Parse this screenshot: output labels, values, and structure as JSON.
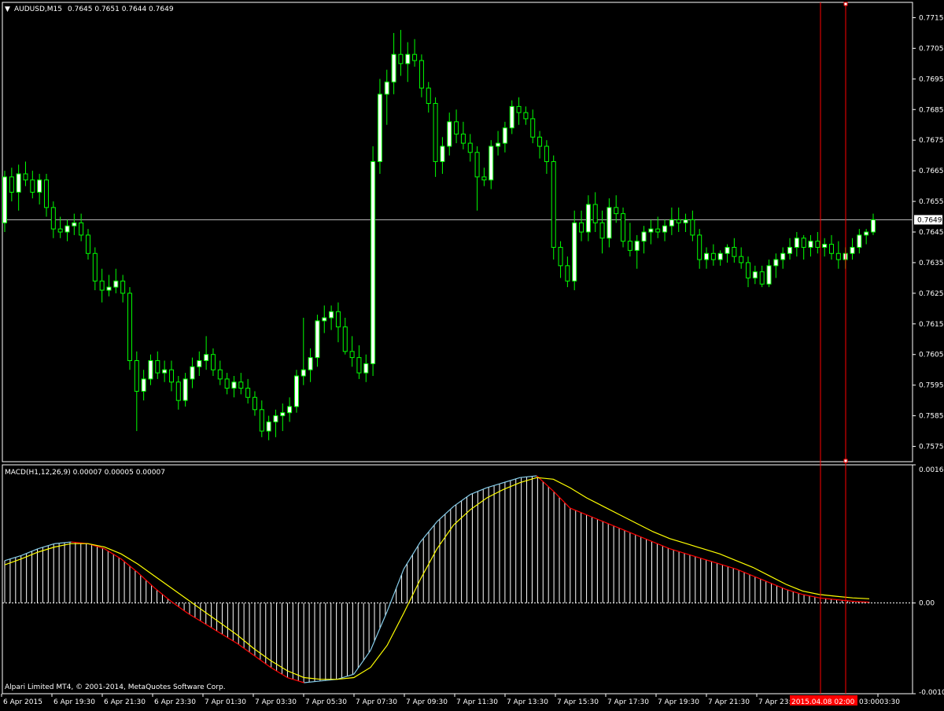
{
  "symbol_header": {
    "symbol": "AUDUSD,M15",
    "ohlc_text": "0.7645 0.7651 0.7644 0.7649"
  },
  "colors": {
    "background": "#000000",
    "frame": "#ffffff",
    "candle_bull_body": "#ffffff",
    "candle_wick": "#00ff00",
    "bid_line": "#c0c0c0",
    "vline": "#ff0000",
    "macd_hist_rising": "#87ceeb",
    "macd_hist": "#ffffff",
    "macd_signal": "#ffff00",
    "macd_falling": "#ff0000",
    "time_marker_bg": "#ff0000"
  },
  "price_axis": {
    "ticks": [
      "0.7715",
      "0.7705",
      "0.7695",
      "0.7685",
      "0.7675",
      "0.7665",
      "0.7655",
      "0.7645",
      "0.7635",
      "0.7625",
      "0.7615",
      "0.7605",
      "0.7595",
      "0.7585",
      "0.7575"
    ],
    "current_price": "0.7649"
  },
  "indicator": {
    "label": "MACD(H1,12,26,9) 0.00007 0.00005 0.00007",
    "axis_ticks": [
      "0.00163",
      "0.00",
      "-0.00107"
    ]
  },
  "copyright": "Alpari Limited MT4, © 2001-2014, MetaQuotes Software Corp.",
  "time_axis": {
    "labels": [
      "6 Apr 2015",
      "6 Apr 19:30",
      "6 Apr 21:30",
      "6 Apr 23:30",
      "7 Apr 01:30",
      "7 Apr 03:30",
      "7 Apr 05:30",
      "7 Apr 07:30",
      "7 Apr 09:30",
      "7 Apr 11:30",
      "7 Apr 13:30",
      "7 Apr 15:30",
      "7 Apr 17:30",
      "7 Apr 19:30",
      "7 Apr 21:30",
      "7 Apr 23:",
      "03:30"
    ],
    "cursor_time": "2015.04.08 02:00",
    "cursor_time_2": "03:00"
  },
  "chart_data": [
    {
      "type": "candlestick",
      "title": "AUDUSD,M15",
      "timeframe": "M15",
      "ylim": [
        0.757,
        0.772
      ],
      "current_price": 0.7649,
      "candles": [
        [
          0.7648,
          0.7665,
          0.7645,
          0.7663
        ],
        [
          0.7663,
          0.7666,
          0.7655,
          0.7658
        ],
        [
          0.7658,
          0.7667,
          0.7652,
          0.7664
        ],
        [
          0.7664,
          0.7668,
          0.766,
          0.7662
        ],
        [
          0.7662,
          0.7665,
          0.7656,
          0.7658
        ],
        [
          0.7658,
          0.7664,
          0.7654,
          0.7662
        ],
        [
          0.7662,
          0.7664,
          0.765,
          0.7653
        ],
        [
          0.7653,
          0.7655,
          0.7643,
          0.7646
        ],
        [
          0.7646,
          0.765,
          0.7643,
          0.7645
        ],
        [
          0.7645,
          0.7649,
          0.7642,
          0.7647
        ],
        [
          0.7647,
          0.7651,
          0.7644,
          0.7648
        ],
        [
          0.7648,
          0.7651,
          0.7642,
          0.7644
        ],
        [
          0.7644,
          0.7646,
          0.7636,
          0.7638
        ],
        [
          0.7638,
          0.764,
          0.7626,
          0.7629
        ],
        [
          0.7629,
          0.7633,
          0.7622,
          0.7626
        ],
        [
          0.7626,
          0.7631,
          0.7624,
          0.7627
        ],
        [
          0.7627,
          0.7633,
          0.7625,
          0.7629
        ],
        [
          0.7629,
          0.7631,
          0.7622,
          0.7625
        ],
        [
          0.7625,
          0.7627,
          0.76,
          0.7603
        ],
        [
          0.7603,
          0.7606,
          0.758,
          0.7593
        ],
        [
          0.7593,
          0.76,
          0.759,
          0.7597
        ],
        [
          0.7597,
          0.7605,
          0.7595,
          0.7603
        ],
        [
          0.7603,
          0.7606,
          0.7597,
          0.7599
        ],
        [
          0.7599,
          0.7603,
          0.7596,
          0.76
        ],
        [
          0.76,
          0.7603,
          0.7593,
          0.7596
        ],
        [
          0.7596,
          0.7598,
          0.7587,
          0.759
        ],
        [
          0.759,
          0.7599,
          0.7588,
          0.7597
        ],
        [
          0.7597,
          0.7604,
          0.7594,
          0.7601
        ],
        [
          0.7601,
          0.7606,
          0.7598,
          0.7603
        ],
        [
          0.7603,
          0.7611,
          0.76,
          0.7605
        ],
        [
          0.7605,
          0.7607,
          0.7598,
          0.76
        ],
        [
          0.76,
          0.7603,
          0.7595,
          0.7597
        ],
        [
          0.7597,
          0.7599,
          0.7592,
          0.7594
        ],
        [
          0.7594,
          0.7598,
          0.7591,
          0.7596
        ],
        [
          0.7596,
          0.7599,
          0.7592,
          0.7594
        ],
        [
          0.7594,
          0.7597,
          0.7589,
          0.7591
        ],
        [
          0.7591,
          0.7593,
          0.7585,
          0.7587
        ],
        [
          0.7587,
          0.759,
          0.7578,
          0.758
        ],
        [
          0.758,
          0.7585,
          0.7577,
          0.7583
        ],
        [
          0.7583,
          0.7587,
          0.7578,
          0.7585
        ],
        [
          0.7585,
          0.7589,
          0.758,
          0.7586
        ],
        [
          0.7586,
          0.7591,
          0.7583,
          0.7588
        ],
        [
          0.7588,
          0.76,
          0.7586,
          0.7598
        ],
        [
          0.7598,
          0.7617,
          0.7595,
          0.76
        ],
        [
          0.76,
          0.7607,
          0.7596,
          0.7604
        ],
        [
          0.7604,
          0.7618,
          0.7601,
          0.7616
        ],
        [
          0.7616,
          0.7621,
          0.7612,
          0.7617
        ],
        [
          0.7617,
          0.7621,
          0.7613,
          0.7619
        ],
        [
          0.7619,
          0.7622,
          0.7609,
          0.7614
        ],
        [
          0.7614,
          0.7617,
          0.7605,
          0.7606
        ],
        [
          0.7606,
          0.7611,
          0.7601,
          0.7604
        ],
        [
          0.7604,
          0.7608,
          0.7597,
          0.7599
        ],
        [
          0.7599,
          0.7605,
          0.7596,
          0.7602
        ],
        [
          0.7602,
          0.7673,
          0.7598,
          0.7668
        ],
        [
          0.7668,
          0.7695,
          0.7664,
          0.769
        ],
        [
          0.769,
          0.7698,
          0.768,
          0.7694
        ],
        [
          0.7694,
          0.771,
          0.769,
          0.7703
        ],
        [
          0.7703,
          0.7711,
          0.7696,
          0.77
        ],
        [
          0.77,
          0.7707,
          0.7694,
          0.7703
        ],
        [
          0.7703,
          0.7708,
          0.7699,
          0.7701
        ],
        [
          0.7701,
          0.7703,
          0.7689,
          0.7692
        ],
        [
          0.7692,
          0.7694,
          0.7684,
          0.7687
        ],
        [
          0.7687,
          0.7689,
          0.7663,
          0.7668
        ],
        [
          0.7668,
          0.7676,
          0.7664,
          0.7673
        ],
        [
          0.7673,
          0.7684,
          0.767,
          0.7681
        ],
        [
          0.7681,
          0.7685,
          0.7674,
          0.7677
        ],
        [
          0.7677,
          0.7681,
          0.7672,
          0.7674
        ],
        [
          0.7674,
          0.7677,
          0.7668,
          0.7671
        ],
        [
          0.7671,
          0.7673,
          0.7652,
          0.7663
        ],
        [
          0.7663,
          0.7666,
          0.766,
          0.7662
        ],
        [
          0.7662,
          0.7675,
          0.7659,
          0.7673
        ],
        [
          0.7673,
          0.7678,
          0.767,
          0.7674
        ],
        [
          0.7674,
          0.7681,
          0.7671,
          0.7679
        ],
        [
          0.7679,
          0.7688,
          0.7677,
          0.7686
        ],
        [
          0.7686,
          0.7689,
          0.768,
          0.7684
        ],
        [
          0.7684,
          0.7686,
          0.768,
          0.7682
        ],
        [
          0.7682,
          0.7685,
          0.7674,
          0.7676
        ],
        [
          0.7676,
          0.7678,
          0.7669,
          0.7673
        ],
        [
          0.7673,
          0.7675,
          0.7664,
          0.7668
        ],
        [
          0.7668,
          0.767,
          0.7636,
          0.764
        ],
        [
          0.764,
          0.7642,
          0.763,
          0.7634
        ],
        [
          0.7634,
          0.7637,
          0.7627,
          0.7629
        ],
        [
          0.7629,
          0.7652,
          0.7626,
          0.7648
        ],
        [
          0.7648,
          0.7652,
          0.7642,
          0.7645
        ],
        [
          0.7645,
          0.7657,
          0.7642,
          0.7654
        ],
        [
          0.7654,
          0.7658,
          0.7645,
          0.7648
        ],
        [
          0.7648,
          0.7652,
          0.7638,
          0.7643
        ],
        [
          0.7643,
          0.7656,
          0.764,
          0.7653
        ],
        [
          0.7653,
          0.7657,
          0.7648,
          0.7651
        ],
        [
          0.7651,
          0.7653,
          0.764,
          0.7642
        ],
        [
          0.7642,
          0.7648,
          0.7637,
          0.7639
        ],
        [
          0.7639,
          0.7644,
          0.7633,
          0.7642
        ],
        [
          0.7642,
          0.7647,
          0.7638,
          0.7645
        ],
        [
          0.7645,
          0.7649,
          0.7641,
          0.7646
        ],
        [
          0.7646,
          0.765,
          0.7643,
          0.7645
        ],
        [
          0.7645,
          0.7649,
          0.7642,
          0.7647
        ],
        [
          0.7647,
          0.7653,
          0.7644,
          0.7649
        ],
        [
          0.7649,
          0.7653,
          0.7645,
          0.7648
        ],
        [
          0.7648,
          0.7651,
          0.7645,
          0.7649
        ],
        [
          0.7649,
          0.7652,
          0.7642,
          0.7644
        ],
        [
          0.7644,
          0.7646,
          0.7633,
          0.7636
        ],
        [
          0.7636,
          0.764,
          0.7633,
          0.7638
        ],
        [
          0.7638,
          0.7641,
          0.7634,
          0.7636
        ],
        [
          0.7636,
          0.7639,
          0.7634,
          0.7638
        ],
        [
          0.7638,
          0.7641,
          0.7635,
          0.764
        ],
        [
          0.764,
          0.7643,
          0.7635,
          0.7637
        ],
        [
          0.7637,
          0.764,
          0.7633,
          0.7635
        ],
        [
          0.7635,
          0.7637,
          0.7627,
          0.763
        ],
        [
          0.763,
          0.7634,
          0.7628,
          0.7632
        ],
        [
          0.7632,
          0.7634,
          0.7627,
          0.7628
        ],
        [
          0.7628,
          0.7636,
          0.7627,
          0.7634
        ],
        [
          0.7634,
          0.7638,
          0.763,
          0.7636
        ],
        [
          0.7636,
          0.764,
          0.7633,
          0.7638
        ],
        [
          0.7638,
          0.7643,
          0.7636,
          0.764
        ],
        [
          0.764,
          0.7645,
          0.7637,
          0.7643
        ],
        [
          0.7643,
          0.7644,
          0.7636,
          0.764
        ],
        [
          0.764,
          0.7644,
          0.7637,
          0.7642
        ],
        [
          0.7642,
          0.7645,
          0.7638,
          0.764
        ],
        [
          0.764,
          0.7643,
          0.7637,
          0.7641
        ],
        [
          0.7641,
          0.7644,
          0.7636,
          0.7638
        ],
        [
          0.7638,
          0.7642,
          0.7633,
          0.7636
        ],
        [
          0.7636,
          0.764,
          0.7633,
          0.7638
        ],
        [
          0.7638,
          0.7643,
          0.7636,
          0.764
        ],
        [
          0.764,
          0.7646,
          0.7638,
          0.7644
        ],
        [
          0.7644,
          0.7646,
          0.7641,
          0.7645
        ],
        [
          0.7645,
          0.7651,
          0.7644,
          0.7649
        ]
      ]
    },
    {
      "type": "line",
      "title": "MACD(H1,12,26,9) 0.00007 0.00005 0.00007",
      "ylim": [
        -0.00107,
        0.00163
      ],
      "series": [
        {
          "values": [
            0.0005,
            0.00056,
            0.00064,
            0.0007,
            0.00072,
            0.0007,
            0.00064,
            0.00052,
            0.00036,
            0.00018,
            2e-05,
            -0.00012,
            -0.00024,
            -0.00036,
            -0.00048,
            -0.00062,
            -0.00076,
            -0.00088,
            -0.00094,
            -0.00092,
            -0.0009,
            -0.00084,
            -0.00056,
            -0.0001,
            0.0004,
            0.00072,
            0.00096,
            0.00114,
            0.00128,
            0.00136,
            0.00142,
            0.00148,
            0.0015,
            0.00132,
            0.00112,
            0.00104,
            0.00096,
            0.00088,
            0.0008,
            0.00072,
            0.00064,
            0.00058,
            0.00052,
            0.00046,
            0.0004,
            0.00032,
            0.00024,
            0.00016,
            0.0001,
            6e-05,
            4e-05,
            2e-05,
            1e-05
          ]
        },
        {
          "values": [
            0.00045,
            0.00052,
            0.0006,
            0.00066,
            0.0007,
            0.0007,
            0.00066,
            0.00058,
            0.00046,
            0.00032,
            0.00018,
            4e-05,
            -0.0001,
            -0.00024,
            -0.00038,
            -0.00054,
            -0.00068,
            -0.0008,
            -0.00088,
            -0.0009,
            -0.0009,
            -0.00088,
            -0.00076,
            -0.0005,
            -0.00012,
            0.00028,
            0.00064,
            0.00092,
            0.0011,
            0.00124,
            0.00134,
            0.00142,
            0.00148,
            0.00146,
            0.00136,
            0.00124,
            0.00114,
            0.00104,
            0.00094,
            0.00084,
            0.00076,
            0.0007,
            0.00064,
            0.00058,
            0.0005,
            0.00042,
            0.00032,
            0.00022,
            0.00014,
            0.0001,
            8e-05,
            6e-05,
            5e-05
          ]
        }
      ]
    }
  ]
}
